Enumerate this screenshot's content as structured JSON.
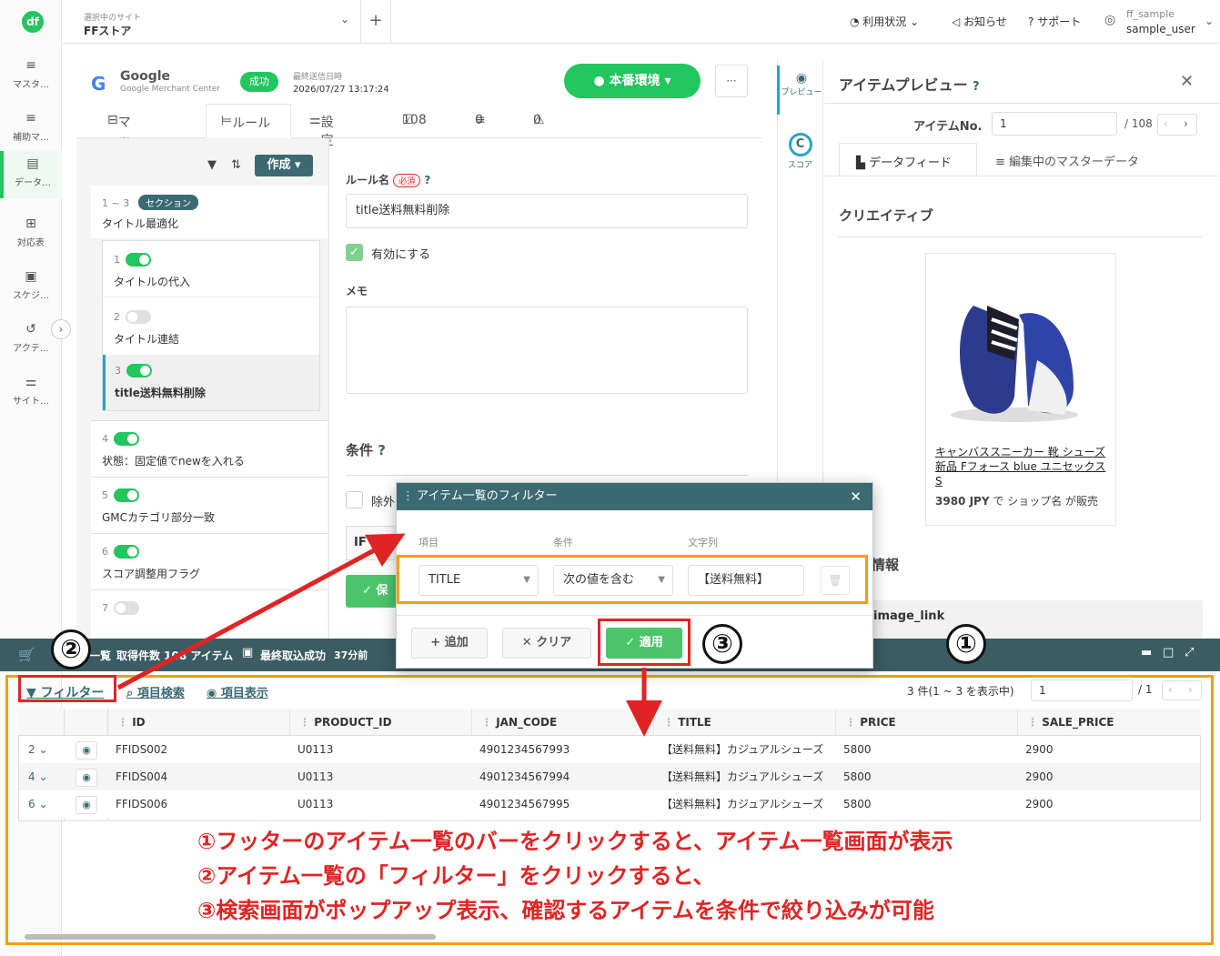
{
  "nav": {
    "logo": "df",
    "items": [
      {
        "label": "マスタ…",
        "icon": "database-icon"
      },
      {
        "label": "補助マ…",
        "icon": "database-plus-icon"
      },
      {
        "label": "データ…",
        "icon": "document-icon"
      },
      {
        "label": "対応表",
        "icon": "table-icon"
      },
      {
        "label": "スケジ…",
        "icon": "calendar-icon"
      },
      {
        "label": "アクテ…",
        "icon": "history-icon"
      },
      {
        "label": "サイト…",
        "icon": "sliders-icon"
      }
    ]
  },
  "header": {
    "site_caption": "選択中のサイト",
    "site_name": "FFストア",
    "plus": "+",
    "usage": "利用状況",
    "news": "お知らせ",
    "support": "サポート",
    "user_top": "ff_sample",
    "user_bottom": "sample_user"
  },
  "feed": {
    "name": "Google",
    "sub": "Google Merchant Center",
    "status": "成功",
    "last_sent_label": "最終送信日時",
    "last_sent": "2026/07/27 13:17:24",
    "env_button": "本番環境",
    "more": "···"
  },
  "tabs": {
    "mapping": "マッピング",
    "rule": "ルール",
    "settings": "設定",
    "count_ok": "108",
    "count_x": "0",
    "count_warn": "0"
  },
  "rules": {
    "create": "作成",
    "section_range": "1 ~ 3",
    "section_badge": "セクション",
    "section_title": "タイトル最適化",
    "items": [
      {
        "num": "1",
        "title": "タイトルの代入"
      },
      {
        "num": "2",
        "title": "タイトル連結"
      },
      {
        "num": "3",
        "title": "title送料無料削除"
      },
      {
        "num": "4",
        "title": "状態：固定値でnewを入れる"
      },
      {
        "num": "5",
        "title": "GMCカテゴリ部分一致"
      },
      {
        "num": "6",
        "title": "スコア調整用フラグ"
      },
      {
        "num": "7",
        "title": ""
      }
    ]
  },
  "form": {
    "rule_name_label": "ルール名",
    "required": "必須",
    "rule_name_value": "title送料無料削除",
    "enable_label": "有効にする",
    "memo_label": "メモ",
    "condition_label": "条件",
    "exclude_label": "除外",
    "if_label": "IF",
    "save_label": "保"
  },
  "side_tabs": {
    "preview": "プレビュー",
    "score": "スコア"
  },
  "preview": {
    "title": "アイテムプレビュー",
    "item_no_label": "アイテムNo.",
    "item_no": "1",
    "total": "/ 108",
    "tab_feed": "データフィード",
    "tab_master": "編集中のマスターデータ",
    "creative": "クリエイティブ",
    "product_link": "キャンバススニーカー 靴 シューズ 新品 Fフォース blue ユニセックス S",
    "price": "3980 JPY",
    "price_mid": "で",
    "shop": "ショップ名",
    "sold": "が販売",
    "info_label": "情報",
    "image_link": "image_link"
  },
  "footerbar": {
    "list_label": "一覧",
    "count_text": "取得件数 108 アイテム",
    "last_import_label": "最終取込成功",
    "last_import": "37分前"
  },
  "modal": {
    "title": "アイテム一覧のフィルター",
    "col_item": "項目",
    "col_cond": "条件",
    "col_text": "文字列",
    "item_value": "TITLE",
    "cond_value": "次の値を含む",
    "text_value": "【送料無料】",
    "add": "追加",
    "clear": "クリア",
    "apply": "適用"
  },
  "table": {
    "filter": "フィルター",
    "search": "項目検索",
    "display": "項目表示",
    "pager_text": "3 件(1 ~ 3 を表示中)",
    "page": "1",
    "pages": "/ 1",
    "columns": [
      "ID",
      "PRODUCT_ID",
      "JAN_CODE",
      "TITLE",
      "PRICE",
      "SALE_PRICE"
    ],
    "rows": [
      {
        "no": "2",
        "id": "FFIDS002",
        "product_id": "U0113",
        "jan": "4901234567993",
        "title": "【送料無料】カジュアルシューズ",
        "price": "5800",
        "sale": "2900"
      },
      {
        "no": "4",
        "id": "FFIDS004",
        "product_id": "U0113",
        "jan": "4901234567994",
        "title": "【送料無料】カジュアルシューズ",
        "price": "5800",
        "sale": "2900"
      },
      {
        "no": "6",
        "id": "FFIDS006",
        "product_id": "U0113",
        "jan": "4901234567995",
        "title": "【送料無料】カジュアルシューズ",
        "price": "5800",
        "sale": "2900"
      }
    ]
  },
  "annotations": {
    "c1": "①",
    "c2": "②",
    "c3": "③",
    "line1": "①フッターのアイテム一覧のバーをクリックすると、アイテム一覧画面が表示",
    "line2": "②アイテム一覧の「フィルター」をクリックすると、",
    "line3": "③検索画面がポップアップ表示、確認するアイテムを条件で絞り込みが可能"
  }
}
